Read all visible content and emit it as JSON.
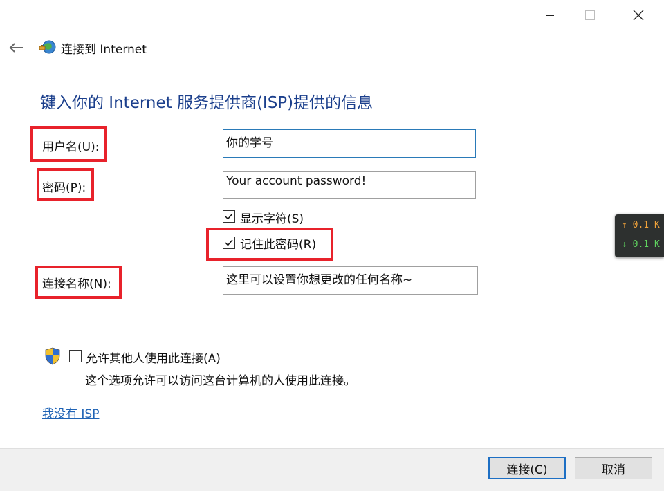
{
  "window": {
    "title_bar_buttons": [
      "minimize",
      "maximize",
      "close"
    ]
  },
  "nav": {
    "back_icon": "back-arrow-icon",
    "app_icon": "network-globe-icon",
    "title": "连接到 Internet"
  },
  "heading": "键入你的 Internet 服务提供商(ISP)提供的信息",
  "form": {
    "username": {
      "label": "用户名(U):",
      "value": "你的学号"
    },
    "password": {
      "label": "密码(P):",
      "value": "Your account password!"
    },
    "show_chars": {
      "label": "显示字符(S)",
      "checked": true
    },
    "remember_password": {
      "label": "记住此密码(R)",
      "checked": true
    },
    "connection_name": {
      "label": "连接名称(N):",
      "value": "这里可以设置你想更改的任何名称~"
    },
    "allow_others": {
      "label": "允许其他人使用此连接(A)",
      "checked": false,
      "icon": "uac-shield-icon"
    },
    "allow_others_desc": "这个选项允许可以访问这台计算机的人使用此连接。"
  },
  "link": {
    "no_isp": "我没有 ISP"
  },
  "buttons": {
    "connect": "连接(C)",
    "cancel": "取消"
  },
  "net_monitor": {
    "upload": "0.1 K",
    "download": "0.1 K",
    "upload_color": "#f0a23a",
    "download_color": "#5fd35f"
  },
  "colors": {
    "heading": "#1b3f8c",
    "highlight_box": "#e8222b",
    "link": "#1f63b5",
    "primary_button_border": "#1d6fc4"
  }
}
